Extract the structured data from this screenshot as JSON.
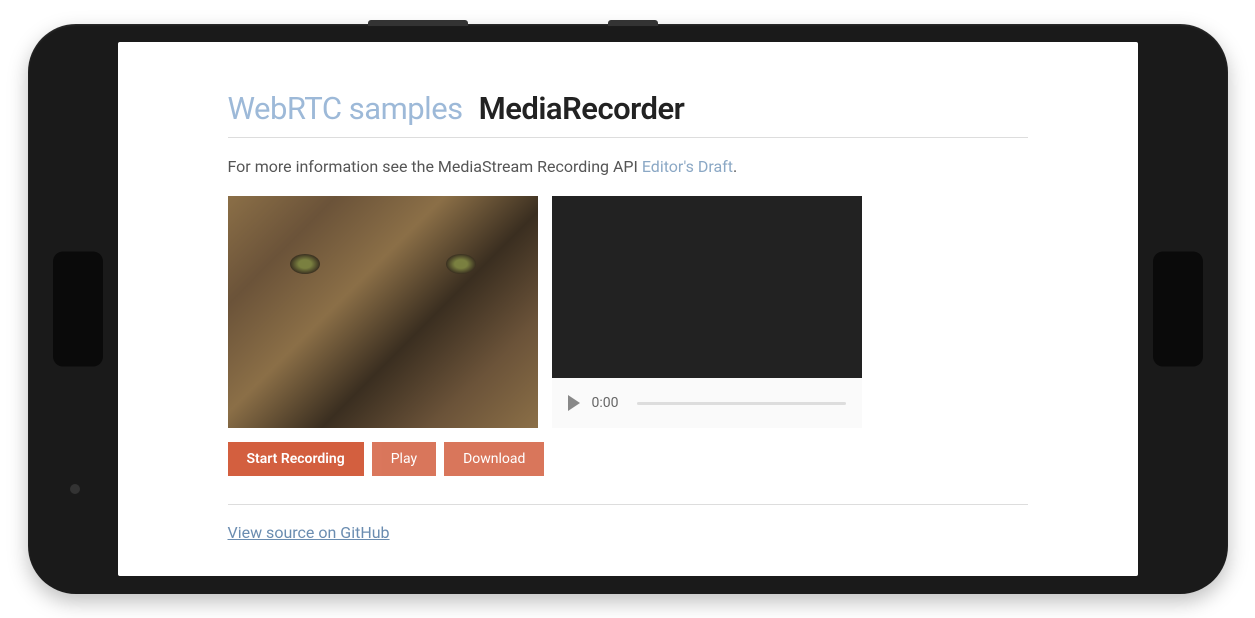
{
  "header": {
    "link_text": "WebRTC samples",
    "title": "MediaRecorder"
  },
  "description": {
    "prefix": "For more information see the MediaStream Recording API ",
    "link_text": "Editor's Draft",
    "suffix": "."
  },
  "video_player": {
    "time": "0:00"
  },
  "buttons": {
    "start_recording": "Start Recording",
    "play": "Play",
    "download": "Download"
  },
  "footer": {
    "source_link": "View source on GitHub"
  },
  "colors": {
    "button_bg": "#d35f3f",
    "link": "#9db9d8"
  }
}
